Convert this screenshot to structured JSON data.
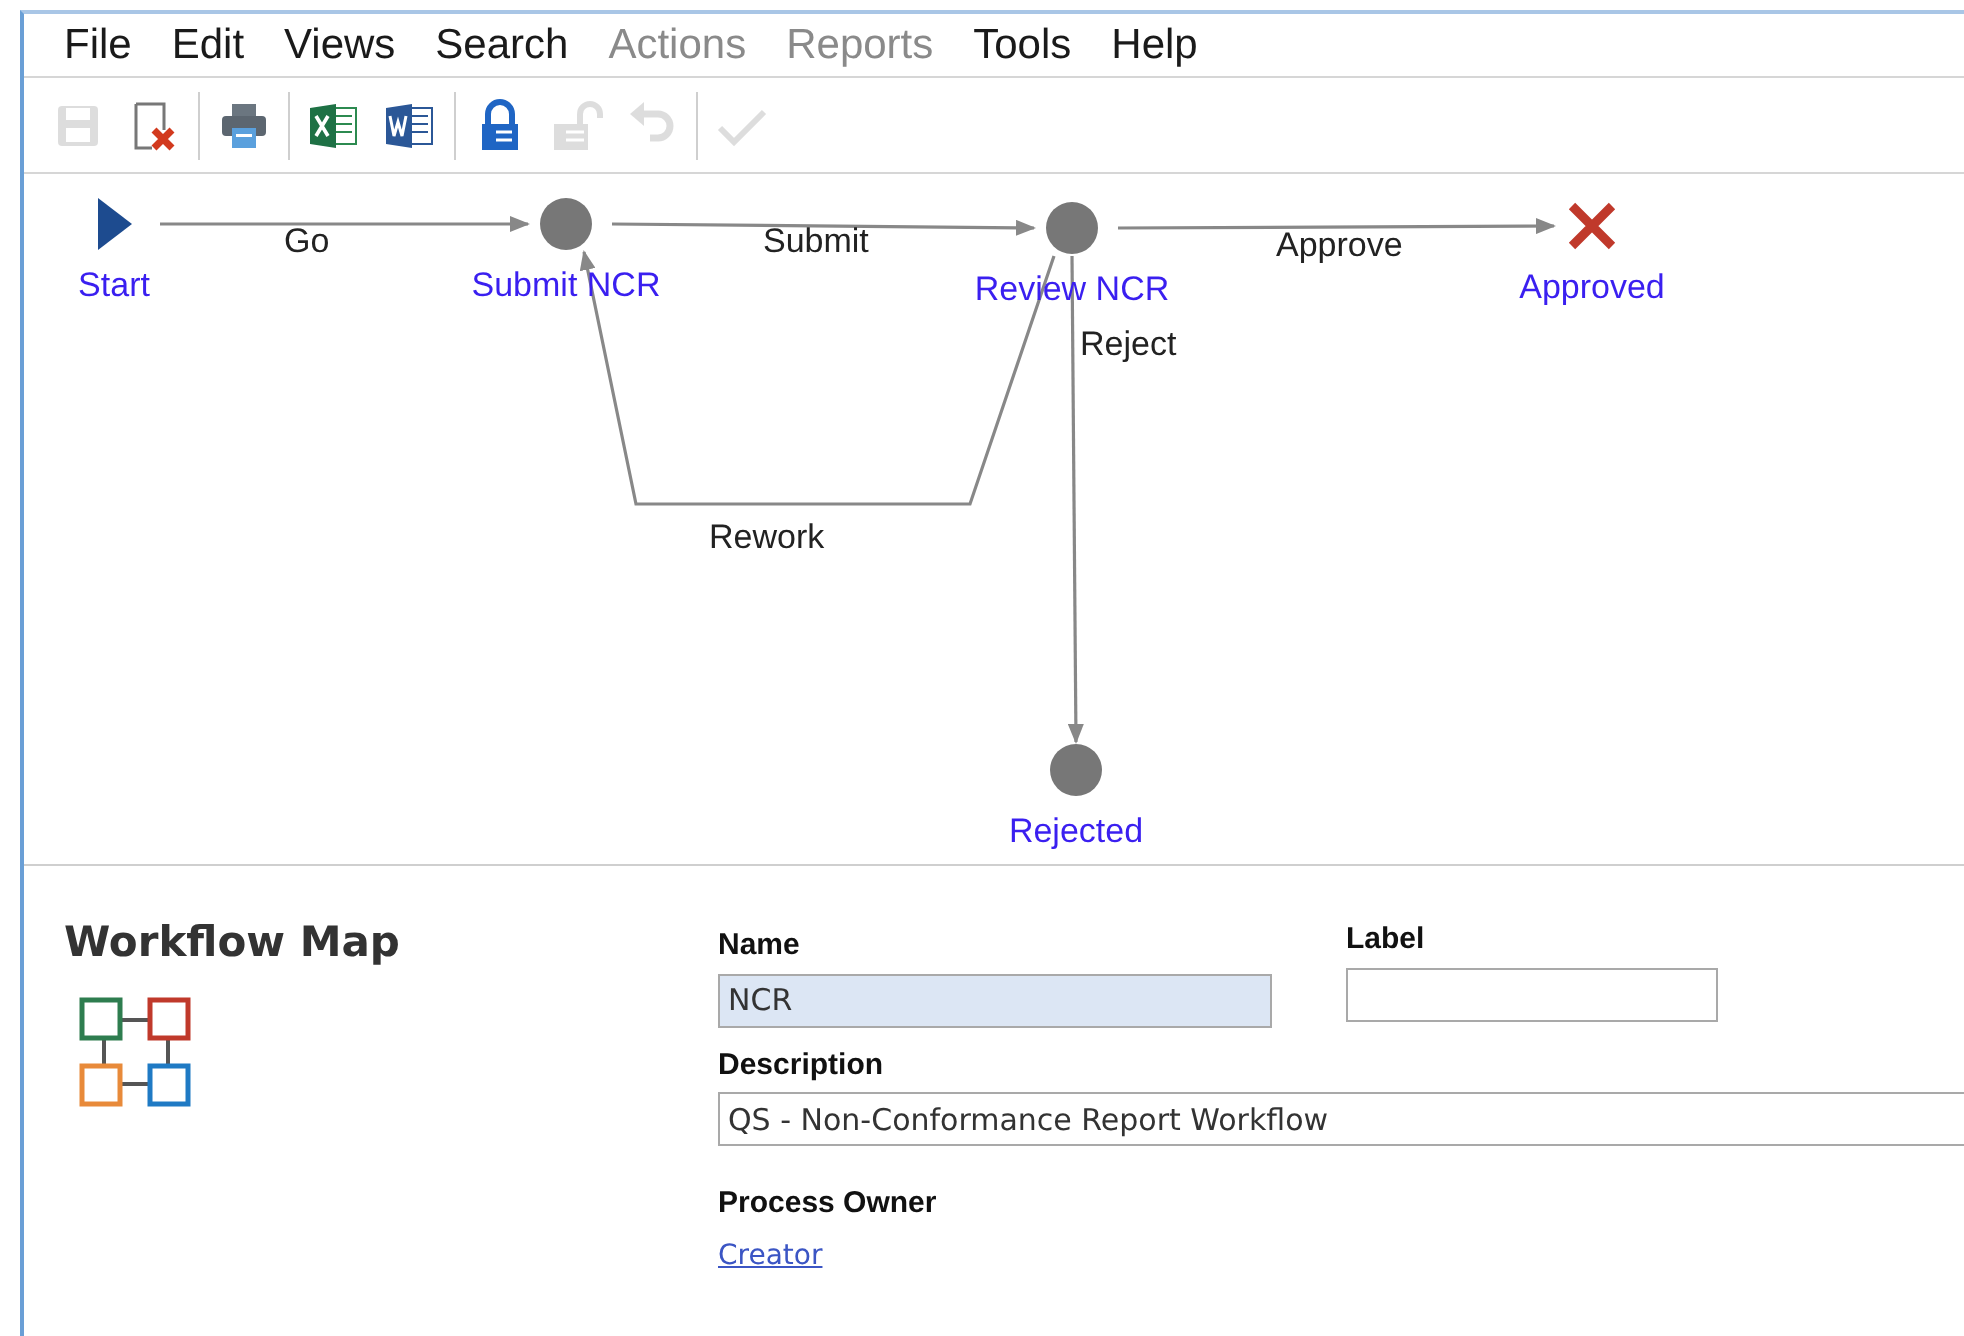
{
  "menu": [
    {
      "label": "File",
      "disabled": false
    },
    {
      "label": "Edit",
      "disabled": false
    },
    {
      "label": "Views",
      "disabled": false
    },
    {
      "label": "Search",
      "disabled": false
    },
    {
      "label": "Actions",
      "disabled": true
    },
    {
      "label": "Reports",
      "disabled": true
    },
    {
      "label": "Tools",
      "disabled": false
    },
    {
      "label": "Help",
      "disabled": false
    }
  ],
  "toolbar": [
    [
      {
        "kind": "save",
        "disabled": true
      },
      {
        "kind": "delete",
        "disabled": false
      }
    ],
    [
      {
        "kind": "print",
        "disabled": false
      }
    ],
    [
      {
        "kind": "excel",
        "disabled": false
      },
      {
        "kind": "word",
        "disabled": false
      }
    ],
    [
      {
        "kind": "lock",
        "disabled": false
      },
      {
        "kind": "unlock",
        "disabled": true
      },
      {
        "kind": "undo",
        "disabled": true
      }
    ],
    [
      {
        "kind": "check",
        "disabled": true
      }
    ]
  ],
  "workflow": {
    "nodes": [
      {
        "label": "Start",
        "kind": "start"
      },
      {
        "label": "Submit NCR",
        "kind": "step"
      },
      {
        "label": "Review NCR",
        "kind": "step"
      },
      {
        "label": "Approved",
        "kind": "end"
      },
      {
        "label": "Rejected",
        "kind": "step"
      }
    ],
    "edges": [
      {
        "label": "Go"
      },
      {
        "label": "Submit"
      },
      {
        "label": "Approve"
      },
      {
        "label": "Rework"
      },
      {
        "label": "Reject"
      }
    ]
  },
  "details": {
    "title": "Workflow Map",
    "fields": [
      {
        "label": "Name",
        "value": "NCR",
        "readonly": true
      },
      {
        "label": "Label",
        "readonly": false
      },
      {
        "label": "Description",
        "value": "QS - Non-Conformance Report Workflow",
        "readonly": false
      }
    ],
    "process_owner": {
      "label": "Process Owner",
      "link": "Creator"
    }
  }
}
